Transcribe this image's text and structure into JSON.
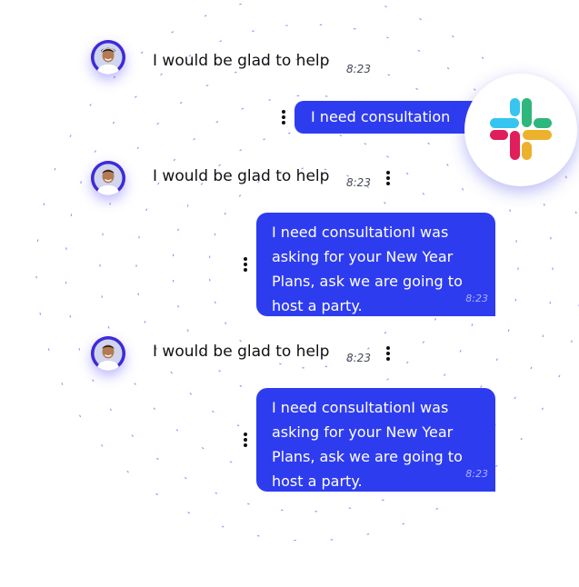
{
  "colors": {
    "accent": "#2e3cf0",
    "avatar_ring": "#3f2ad9",
    "dash": "#7c72f2",
    "slack_blue": "#36c5f0",
    "slack_green": "#2eb67d",
    "slack_yellow": "#ecb22e",
    "slack_red": "#e01e5a"
  },
  "icons": {
    "avatar": "user-avatar",
    "menu": "more-vertical-icon",
    "app": "slack-logo-icon"
  },
  "conversation": {
    "messages": [
      {
        "direction": "incoming",
        "text": "I would be glad to help",
        "time": "8:23"
      },
      {
        "direction": "outgoing",
        "text": "I need consultation"
      },
      {
        "direction": "incoming",
        "text": "I would be glad to help",
        "time": "8:23"
      },
      {
        "direction": "outgoing",
        "text": "I need consultationI was asking for your New Year Plans, ask we are going to host a party.",
        "time": "8:23"
      },
      {
        "direction": "incoming",
        "text": "I would be glad to help",
        "time": "8:23"
      },
      {
        "direction": "outgoing",
        "text": "I need consultationI was asking for your New Year Plans, ask we are going to host a party.",
        "time": "8:23"
      }
    ]
  }
}
